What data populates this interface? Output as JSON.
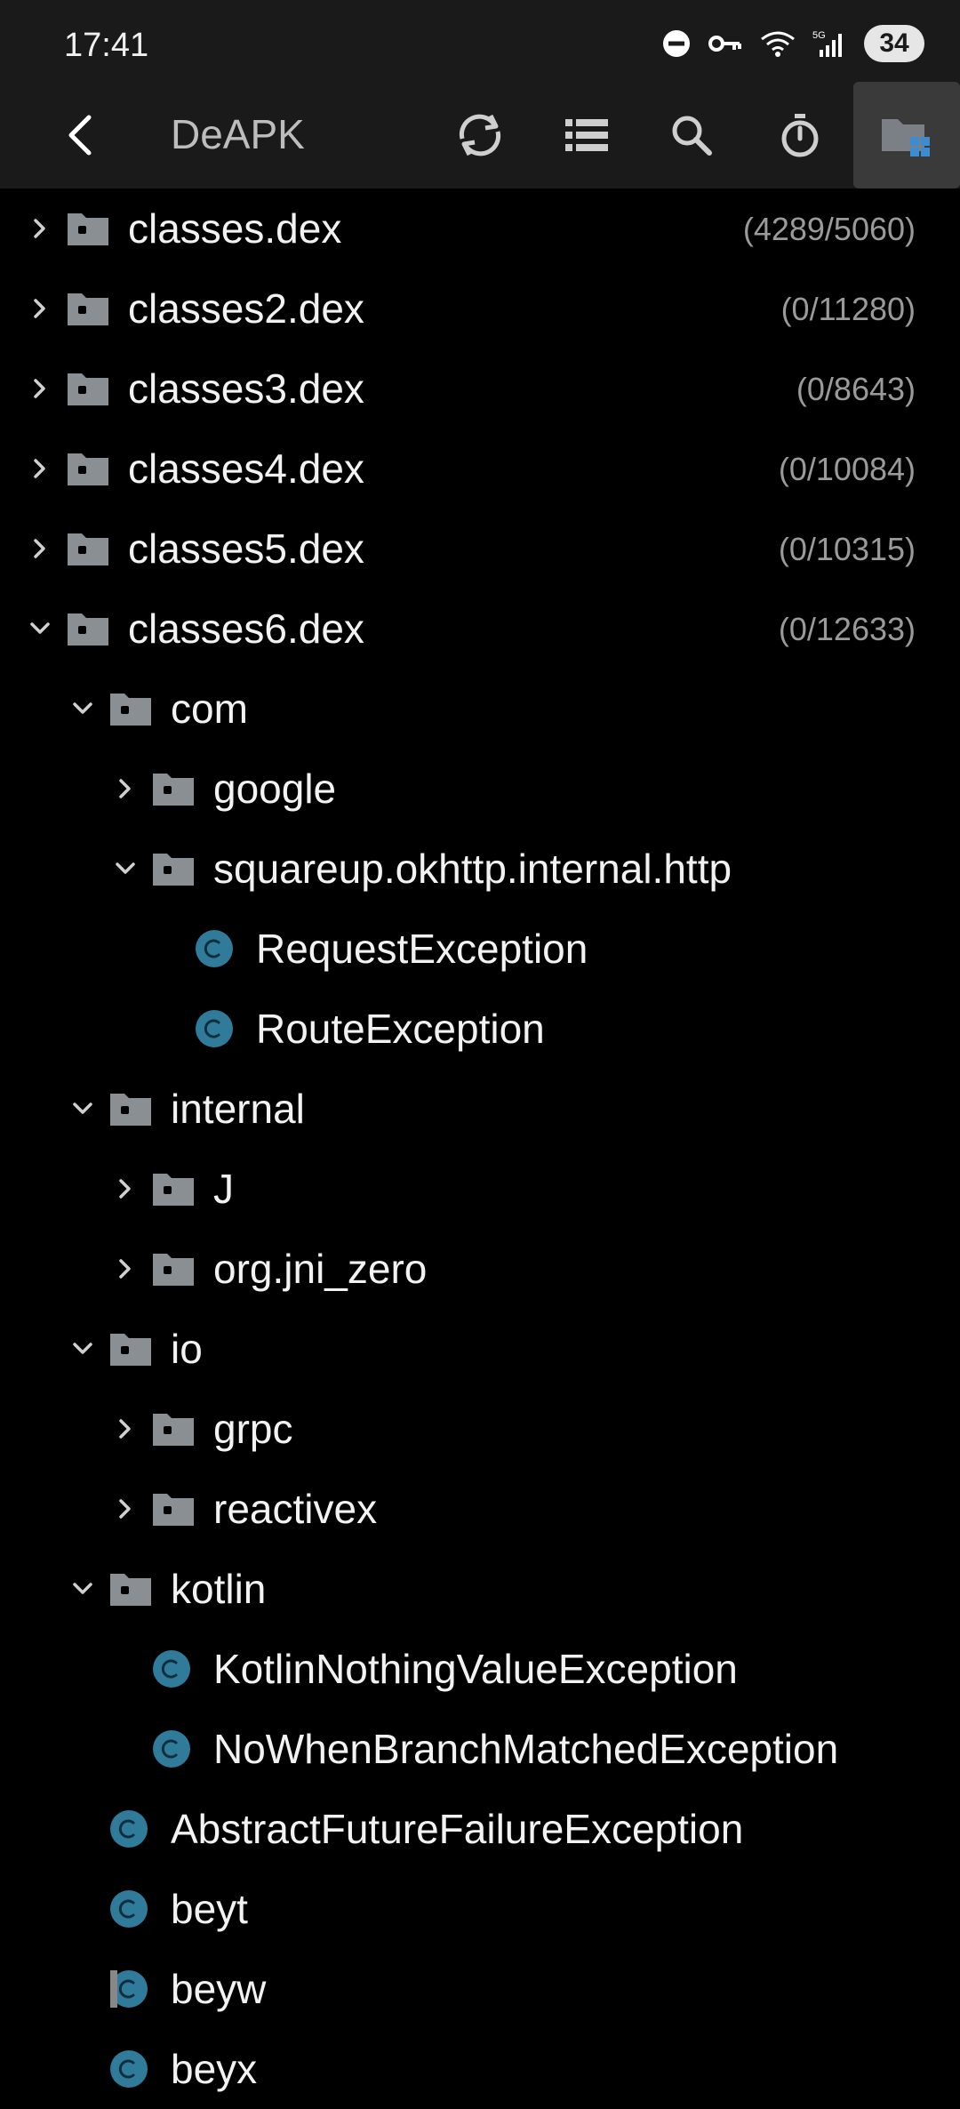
{
  "status_bar": {
    "time": "17:41",
    "battery": "34",
    "icons": [
      "do-not-disturb-icon",
      "vpn-key-icon",
      "wifi-icon",
      "signal-5g-icon"
    ]
  },
  "toolbar": {
    "title": "DeAPK",
    "buttons": [
      "back-arrow-icon",
      "sync-icon",
      "list-icon",
      "search-icon",
      "timer-icon",
      "folder-tree-icon"
    ]
  },
  "colors": {
    "background": "#000000",
    "toolbar": "#1a1a1a",
    "folder": "#8a8f94",
    "class_icon": "#2f7b99",
    "count": "#9a9a9a"
  },
  "tree": [
    {
      "type": "folder",
      "depth": 0,
      "expanded": false,
      "label": "classes.dex",
      "count": "(4289/5060)"
    },
    {
      "type": "folder",
      "depth": 0,
      "expanded": false,
      "label": "classes2.dex",
      "count": "(0/11280)"
    },
    {
      "type": "folder",
      "depth": 0,
      "expanded": false,
      "label": "classes3.dex",
      "count": "(0/8643)"
    },
    {
      "type": "folder",
      "depth": 0,
      "expanded": false,
      "label": "classes4.dex",
      "count": "(0/10084)"
    },
    {
      "type": "folder",
      "depth": 0,
      "expanded": false,
      "label": "classes5.dex",
      "count": "(0/10315)"
    },
    {
      "type": "folder",
      "depth": 0,
      "expanded": true,
      "label": "classes6.dex",
      "count": "(0/12633)"
    },
    {
      "type": "folder",
      "depth": 1,
      "expanded": true,
      "label": "com"
    },
    {
      "type": "folder",
      "depth": 2,
      "expanded": false,
      "label": "google"
    },
    {
      "type": "folder",
      "depth": 2,
      "expanded": true,
      "label": "squareup.okhttp.internal.http"
    },
    {
      "type": "class",
      "depth": 3,
      "label": "RequestException"
    },
    {
      "type": "class",
      "depth": 3,
      "label": "RouteException"
    },
    {
      "type": "folder",
      "depth": 1,
      "expanded": true,
      "label": "internal"
    },
    {
      "type": "folder",
      "depth": 2,
      "expanded": false,
      "label": "J"
    },
    {
      "type": "folder",
      "depth": 2,
      "expanded": false,
      "label": "org.jni_zero"
    },
    {
      "type": "folder",
      "depth": 1,
      "expanded": true,
      "label": "io"
    },
    {
      "type": "folder",
      "depth": 2,
      "expanded": false,
      "label": "grpc"
    },
    {
      "type": "folder",
      "depth": 2,
      "expanded": false,
      "label": "reactivex"
    },
    {
      "type": "folder",
      "depth": 1,
      "expanded": true,
      "label": "kotlin"
    },
    {
      "type": "class",
      "depth": 2,
      "label": "KotlinNothingValueException"
    },
    {
      "type": "class",
      "depth": 2,
      "label": "NoWhenBranchMatchedException"
    },
    {
      "type": "class",
      "depth": 1,
      "label": "AbstractFutureFailureException"
    },
    {
      "type": "class",
      "depth": 1,
      "label": "beyt"
    },
    {
      "type": "class",
      "depth": 1,
      "label": "beyw",
      "variant": "partial"
    },
    {
      "type": "class",
      "depth": 1,
      "label": "beyx"
    }
  ]
}
